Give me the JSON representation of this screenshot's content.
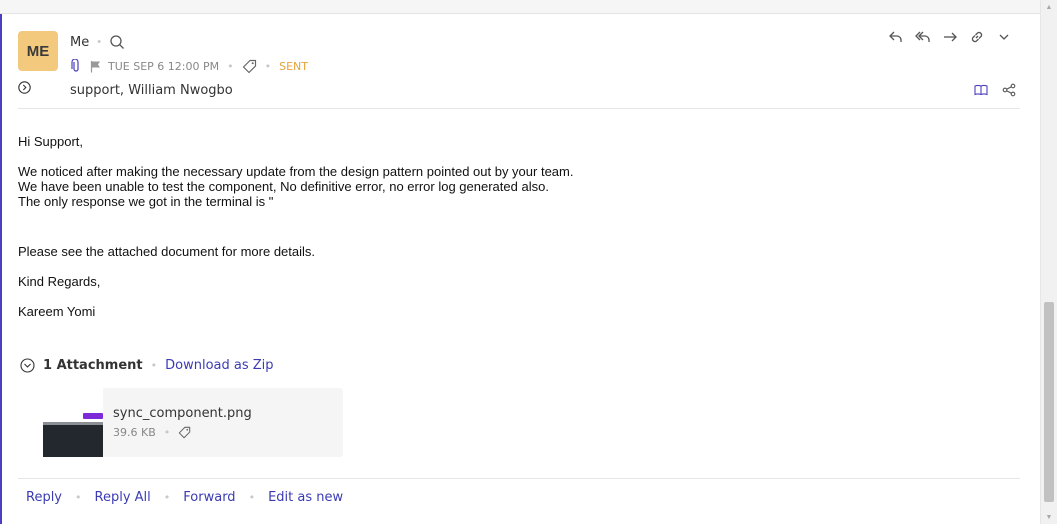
{
  "sender": {
    "initials": "ME",
    "name": "Me",
    "date": "TUE SEP 6 12:00 PM",
    "status": "SENT"
  },
  "recipients": [
    "support",
    "William Nwogbo"
  ],
  "body": {
    "greeting": "Hi Support,",
    "line1": "We noticed after making the necessary update from the design pattern pointed out by your team.",
    "line2": "We have been unable to test the component, No definitive error, no error log generated also.",
    "line3": "The only response we got in the terminal is \"",
    "line4": "Please see the attached document for more details.",
    "closing": "Kind Regards,",
    "signature": "Kareem Yomi"
  },
  "attachments": {
    "count_label": "1 Attachment",
    "download_label": "Download as Zip",
    "files": [
      {
        "name": "sync_component.png",
        "size": "39.6 KB"
      }
    ]
  },
  "footer": {
    "reply": "Reply",
    "reply_all": "Reply All",
    "forward": "Forward",
    "edit_as_new": "Edit as new"
  },
  "colors": {
    "accent": "#3b3bb3",
    "avatar_bg": "#f3c97e",
    "sent_status": "#e8a33a",
    "left_accent": "#4b3fbf"
  },
  "icons": {
    "sender_row": "search-icon",
    "meta_row": [
      "paperclip-icon",
      "flag-icon",
      "tag-icon"
    ],
    "actions": [
      "reply-icon",
      "reply-all-icon",
      "forward-icon",
      "link-icon",
      "chevron-down-icon"
    ],
    "secondary_actions": [
      "book-icon",
      "share-icon"
    ],
    "expand": "expand-circle-icon",
    "attachment_toggle": "collapse-circle-icon",
    "file_tag": "tag-icon"
  }
}
